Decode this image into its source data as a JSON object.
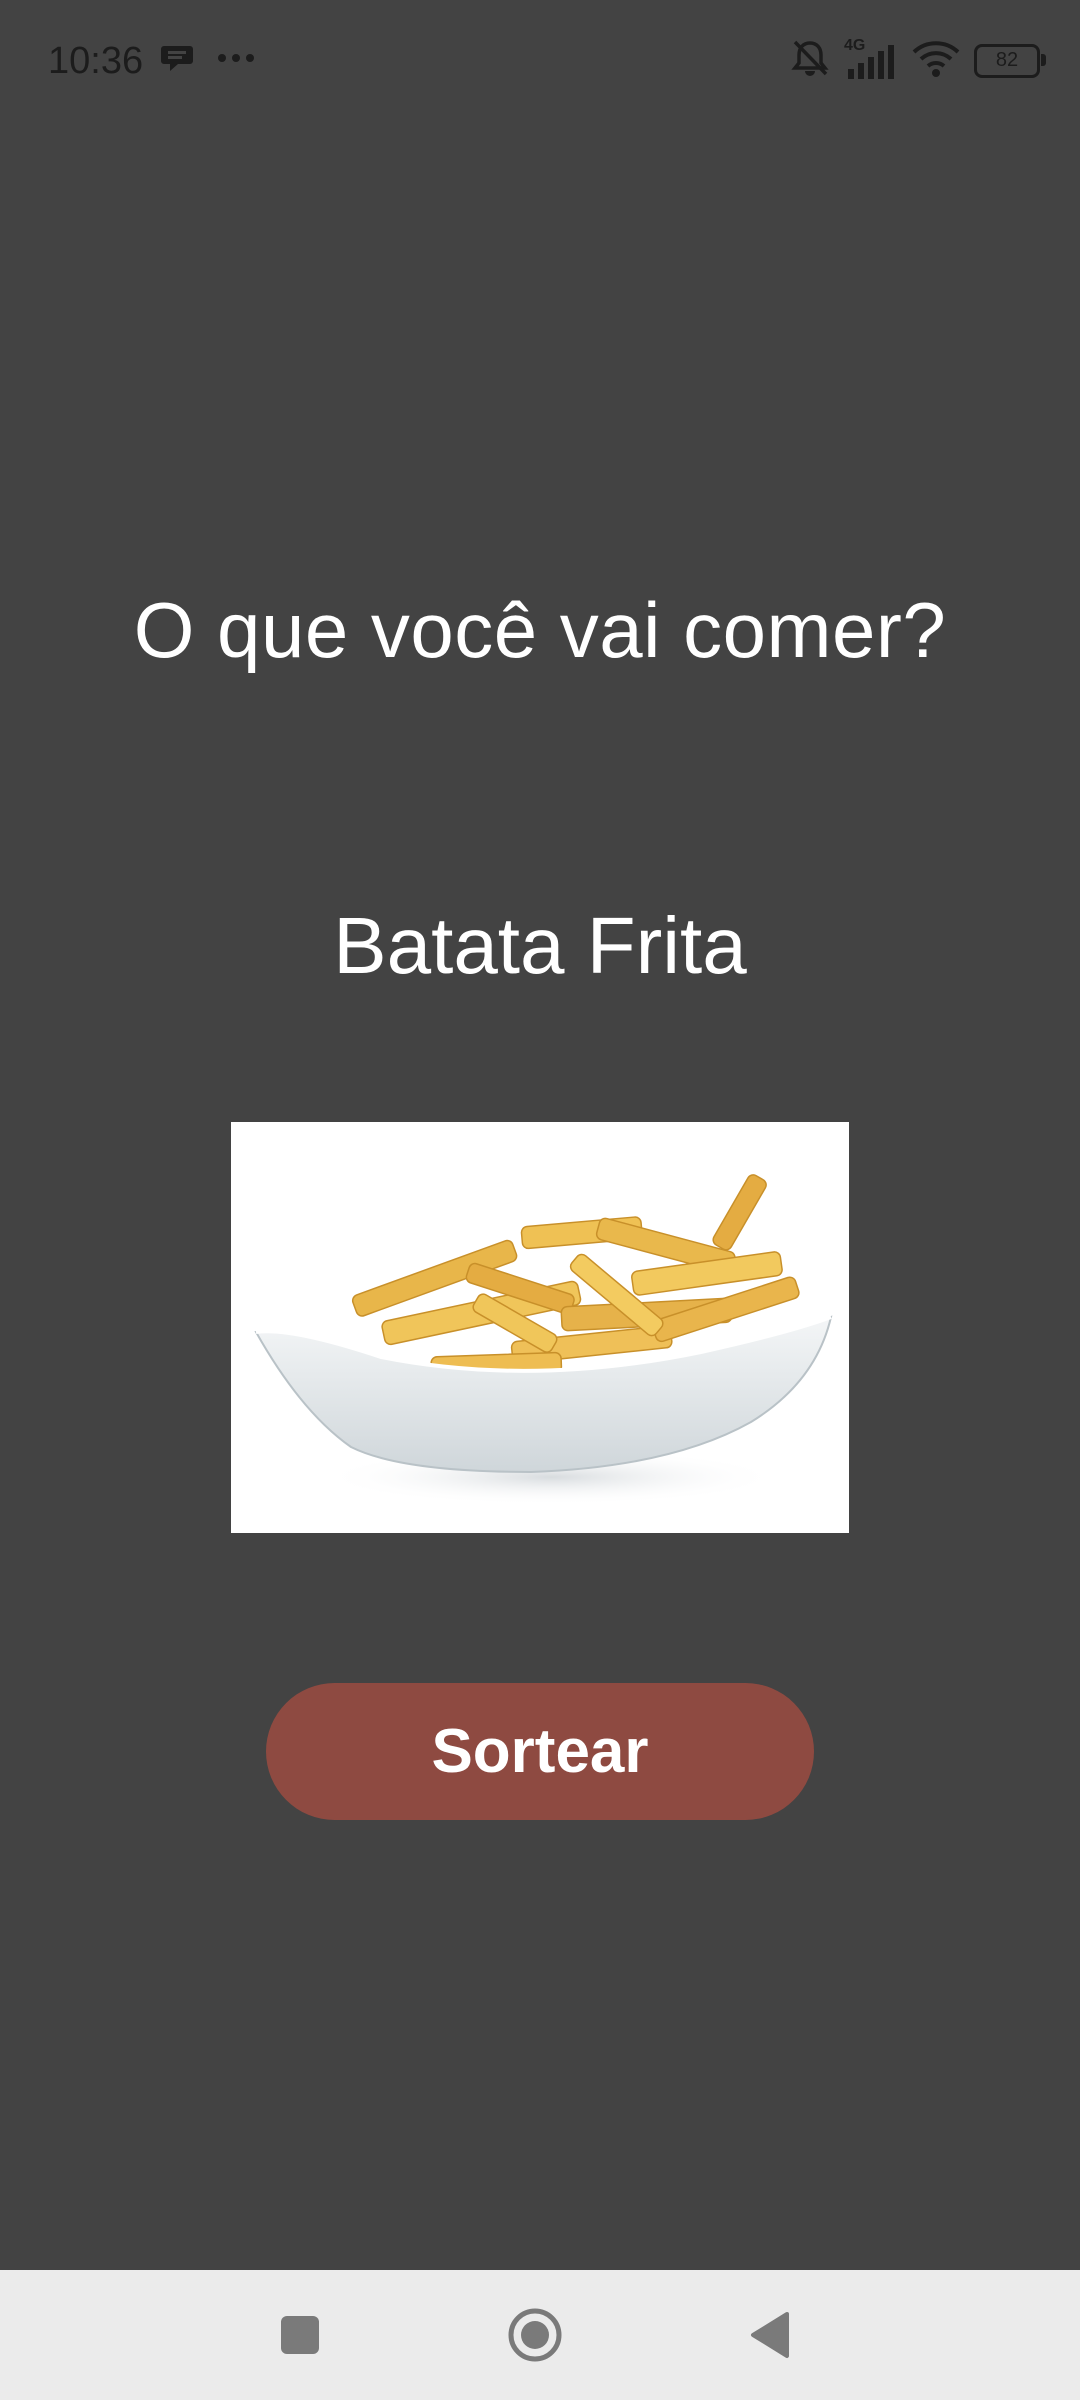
{
  "status_bar": {
    "time": "10:36",
    "network_label": "4G",
    "battery_level": "82",
    "icons": [
      "chat-bubble-icon",
      "more-dots-icon",
      "mute-bell-icon",
      "signal-icon",
      "wifi-icon",
      "battery-icon"
    ]
  },
  "main": {
    "question": "O que você vai comer?",
    "result": "Batata Frita",
    "image": "french-fries-dish",
    "button_label": "Sortear"
  },
  "nav_bar": {
    "icons": [
      "recent-apps-icon",
      "home-icon",
      "back-icon"
    ]
  },
  "colors": {
    "background": "#434343",
    "button": "#8e4a41",
    "text": "#ffffff",
    "nav_bar": "#ebebeb"
  }
}
